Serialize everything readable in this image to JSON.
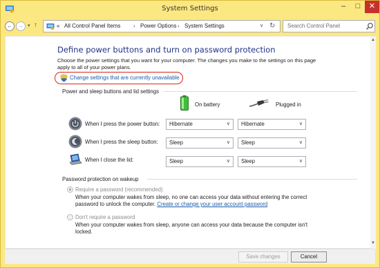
{
  "window": {
    "title": "System Settings",
    "minimize_glyph": "–",
    "maximize_glyph": "□",
    "close_glyph": "✕"
  },
  "nav": {
    "back_glyph": "←",
    "forward_glyph": "→",
    "recent_glyph": "▾",
    "up_glyph": "↑"
  },
  "address": {
    "overflow": "«",
    "crumbs": [
      "All Control Panel Items",
      "Power Options",
      "System Settings"
    ],
    "separator": "›",
    "dropdown_glyph": "∨",
    "refresh_glyph": "↻"
  },
  "search": {
    "placeholder": "Search Control Panel"
  },
  "main": {
    "heading": "Define power buttons and turn on password protection",
    "description": "Choose the power settings that you want for your computer. The changes you make to the settings on this page apply to all of your power plans.",
    "change_link": "Change settings that are currently unavailable"
  },
  "power_group": {
    "title": "Power and sleep buttons and lid settings",
    "col_battery": "On battery",
    "col_plugged": "Plugged in",
    "rows": [
      {
        "label": "When I press the power button:",
        "battery": "Hibernate",
        "plugged": "Hibernate",
        "icon": "power-button-icon"
      },
      {
        "label": "When I press the sleep button:",
        "battery": "Sleep",
        "plugged": "Sleep",
        "icon": "sleep-button-icon"
      },
      {
        "label": "When I close the lid:",
        "battery": "Sleep",
        "plugged": "Sleep",
        "icon": "laptop-lid-icon"
      }
    ],
    "chevron_glyph": "∨"
  },
  "password_group": {
    "title": "Password protection on wakeup",
    "option1_label": "Require a password (recommended)",
    "option1_desc": "When your computer wakes from sleep, no one can access your data without entering the correct password to unlock the computer.",
    "option1_link": "Create or change your user account password",
    "option2_label": "Don't require a password",
    "option2_desc": "When your computer wakes from sleep, anyone can access your data because the computer isn't locked.",
    "selected": "option1"
  },
  "footer": {
    "save_label": "Save changes",
    "cancel_label": "Cancel"
  },
  "scroll": {
    "up_glyph": "▲",
    "down_glyph": "▼"
  },
  "colors": {
    "titlebar": "#fce880",
    "close": "#c7312a",
    "heading": "#1e3287",
    "link": "#1a5aaa",
    "highlight": "#d8231b"
  }
}
